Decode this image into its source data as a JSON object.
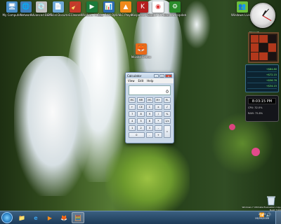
{
  "desktop_icons": [
    {
      "id": "computer",
      "label": "My Computer",
      "color": "#4a8fc9",
      "glyph": "🖥"
    },
    {
      "id": "network",
      "label": "Network",
      "color": "#3f7db8",
      "glyph": "🌐"
    },
    {
      "id": "burning",
      "label": "Advanced Burning S...",
      "color": "#c0c0c0",
      "glyph": "💿"
    },
    {
      "id": "docs",
      "label": "Official Documents...",
      "color": "#6fa8d6",
      "glyph": "📄"
    },
    {
      "id": "ccleaner",
      "label": "CCleaner",
      "color": "#c43a2a",
      "glyph": "🧹"
    },
    {
      "id": "media",
      "label": "Windows Media Center",
      "color": "#1b7a3a",
      "glyph": "▶"
    },
    {
      "id": "freeram",
      "label": "Free RAM Optimizer",
      "color": "#2c6bb0",
      "glyph": "📊"
    },
    {
      "id": "vlc",
      "label": "VLC Player",
      "color": "#ef8a1a",
      "glyph": "▲"
    },
    {
      "id": "kaspersky",
      "label": "Kaspersky Internet Sec",
      "color": "#b41f1f",
      "glyph": "K"
    },
    {
      "id": "chrome",
      "label": "Google Chrome",
      "color": "#ffffff",
      "glyph": "◉"
    },
    {
      "id": "update",
      "label": "Windows Update",
      "color": "#2b8c2b",
      "glyph": "⚙"
    },
    {
      "id": "messenger",
      "label": "Windows Live Mess...",
      "color": "#6bbf3c",
      "glyph": "👥"
    },
    {
      "id": "firefox",
      "label": "Mozilla Firefox",
      "color": "#e86a1a",
      "glyph": "🦊"
    }
  ],
  "clock_gadget": {
    "hour": 1,
    "minute": 7,
    "second": 20
  },
  "puzzle_gadget": {
    "title": "Microsoft",
    "tiles": [
      "r",
      "r",
      "b",
      "r",
      "b",
      "r",
      "r",
      "r",
      "b"
    ]
  },
  "stocks_gadget": {
    "rows": [
      {
        "sym": "",
        "val": "+$84.80"
      },
      {
        "sym": "",
        "val": "+$72.15"
      },
      {
        "sym": "",
        "val": "+$56.76"
      },
      {
        "sym": "",
        "val": "+$34.15"
      }
    ]
  },
  "cpu_gadget": {
    "time": "8:03:15 PM",
    "cpu": "CPU: 32.0%",
    "ram": "RAM: 75.8%"
  },
  "calculator": {
    "title": "Calculator",
    "menu": [
      "View",
      "Edit",
      "Help"
    ],
    "display": "0",
    "keys": [
      "MC",
      "MR",
      "MS",
      "M+",
      "M-",
      "←",
      "CE",
      "C",
      "±",
      "√",
      "7",
      "8",
      "9",
      "/",
      "%",
      "4",
      "5",
      "6",
      "*",
      "1/x",
      "1",
      "2",
      "3",
      "-",
      "=",
      "0",
      ".",
      "+"
    ]
  },
  "taskbar": {
    "items": [
      {
        "id": "explorer",
        "glyph": "📁",
        "color": "#f1c94a",
        "active": false
      },
      {
        "id": "ie",
        "glyph": "e",
        "color": "#3aa0e8",
        "active": false
      },
      {
        "id": "wmp",
        "glyph": "▶",
        "color": "#f38b1c",
        "active": false
      },
      {
        "id": "firefox",
        "glyph": "🦊",
        "color": "#e86a1a",
        "active": false
      },
      {
        "id": "calc",
        "glyph": "🧮",
        "color": "#9fc0df",
        "active": true
      }
    ],
    "tray": {
      "time": "20:53",
      "date": "19/05/2009"
    }
  },
  "recycle_bin": {
    "label": ""
  },
  "watermark": "Windows 7 Ultimate Evaluation copy. Build 7100"
}
